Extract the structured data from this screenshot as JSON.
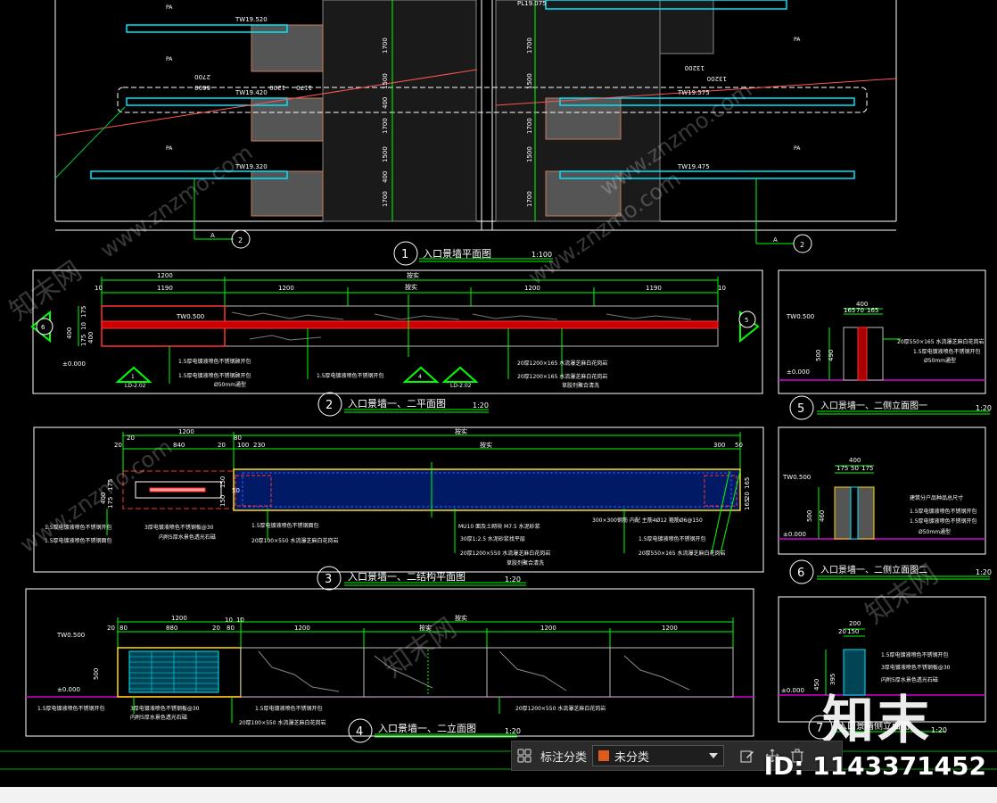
{
  "plan1": {
    "labels": {
      "tw1": "TW19.520",
      "tw2": "TW19.420",
      "tw3": "TW19.320",
      "tw4": "TW19.575",
      "tw5": "TW19.475",
      "pl": "PL19.075",
      "pa": "PA"
    },
    "dims": [
      "1700",
      "1500",
      "400",
      "1700",
      "1500",
      "400",
      "1700",
      "2700",
      "6600",
      "1200",
      "1170",
      "13200"
    ],
    "section_tag": "A",
    "section_num": "2"
  },
  "titles": [
    {
      "num": "1",
      "text": "入口景墙平面图",
      "scale": "1:100"
    },
    {
      "num": "2",
      "text": "入口景墙一、二平面图",
      "scale": "1:20"
    },
    {
      "num": "3",
      "text": "入口景墙一、二结构平面图",
      "scale": "1:20"
    },
    {
      "num": "4",
      "text": "入口景墙一、二立面图",
      "scale": "1:20"
    },
    {
      "num": "5",
      "text": "入口景墙一、二侧立面图一",
      "scale": "1:20"
    },
    {
      "num": "6",
      "text": "入口景墙一、二侧立面图二",
      "scale": "1:20"
    },
    {
      "num": "7",
      "text": "入口景墙侧立面图",
      "scale": "1:20"
    }
  ],
  "p2": {
    "top_dims": [
      "1200",
      "1190",
      "1200",
      "1200",
      "1190",
      "10",
      "10"
    ],
    "total": "按实",
    "side_dims": [
      "400",
      "175",
      "10",
      "175",
      "40",
      "400"
    ],
    "tw": "TW0.500",
    "level": "±0.000",
    "notes": [
      "1.5厚电镀液喷色不锈钢顾开包",
      "1.5厚电镀液喷色不锈钢顾开包",
      "Ø50mm通型",
      "1.5厚电镀液喷色不锈钢开包",
      "20厚1200×165  水流瀑芝麻白花岗岩",
      "20厚1200×165  水流瀑芝麻白花岗岩",
      "草胶剂聚合清洗"
    ],
    "marks": [
      "1",
      "LD-2.02",
      "4",
      "LD-2.02",
      "6",
      "5"
    ]
  },
  "p3": {
    "top_dims": [
      "1200",
      "20",
      "20",
      "840",
      "20",
      "80",
      "100",
      "230",
      "300",
      "50"
    ],
    "total": "按实",
    "side_dims": [
      "400",
      "175",
      "150",
      "50",
      "20",
      "165",
      "20",
      "165"
    ],
    "notes": [
      "1.5厚电镀液喷色不锈钢开包",
      "3厚电镀液喷色不锈钢板@30",
      "内附5厚水景色透光石磁",
      "1.5厚电镀液喷色不锈钢面包",
      "20厚100×550  水流瀑芝麻白花岗岩",
      "MU10 面及土砌块 M7.5 水泥砂浆",
      "30厚1:2.5 水泥砂浆找平层",
      "20厚1200×550  水流瀑芝麻白花岗岩",
      "20厚550×165  水流瀑芝麻白花岗岩",
      "300×300钢筋 内配 主筋4Ø12 箍筋Ø6@150",
      "1.5厚电镀液喷色不锈钢开包"
    ]
  },
  "p4": {
    "top_dims": [
      "1200",
      "20",
      "80",
      "880",
      "20",
      "10",
      "10",
      "80",
      "1200",
      "1200",
      "1200",
      "1200",
      "1200"
    ],
    "total": "按实",
    "tw": "TW0.500",
    "level": "±0.000",
    "height": "500",
    "notes": [
      "1.5厚电镀液喷色不锈钢开包",
      "3厚电镀液喷色不锈钢板@30",
      "内附5厚水景色透光石磁",
      "1.5厚电镀液喷色不锈钢开包",
      "20厚100×550  水流瀑芝麻白花岗岩",
      "20厚1200×550  水流瀑芝麻白花岗岩"
    ]
  },
  "p5": {
    "dims": [
      "400",
      "165",
      "70",
      "165",
      "500",
      "490"
    ],
    "tw": "TW0.500",
    "level": "±0.000",
    "notes": [
      "20厚550×165  水流瀑芝麻白花岗岩",
      "1.5厚电镀液喷色不锈钢开包",
      "Ø50mm通型"
    ]
  },
  "p6": {
    "dims": [
      "400",
      "175",
      "50",
      "175",
      "500",
      "460"
    ],
    "tw": "TW0.500",
    "level": "±0.000",
    "notes": [
      "建筑分户品种品总尺寸",
      "1.5厚电镀液喷色不锈钢开包",
      "1.5厚电镀液喷色不锈钢开包",
      "Ø50mm通型"
    ]
  },
  "p7": {
    "dims": [
      "200",
      "150",
      "20",
      "395",
      "450"
    ],
    "level": "±0.000",
    "notes": [
      "1.5厚电镀液喷色不锈钢开包",
      "3厚电镀液喷色不锈钢板@30",
      "内附5厚水景色透光石磁"
    ]
  },
  "toolbar": {
    "label": "标注分类",
    "selected": "未分类",
    "swatch_color": "#e05a1a"
  },
  "watermark": {
    "id": "ID: 1143371452",
    "logo": "知末",
    "site": "www.znzmo.com",
    "site_cn": "知末网"
  }
}
